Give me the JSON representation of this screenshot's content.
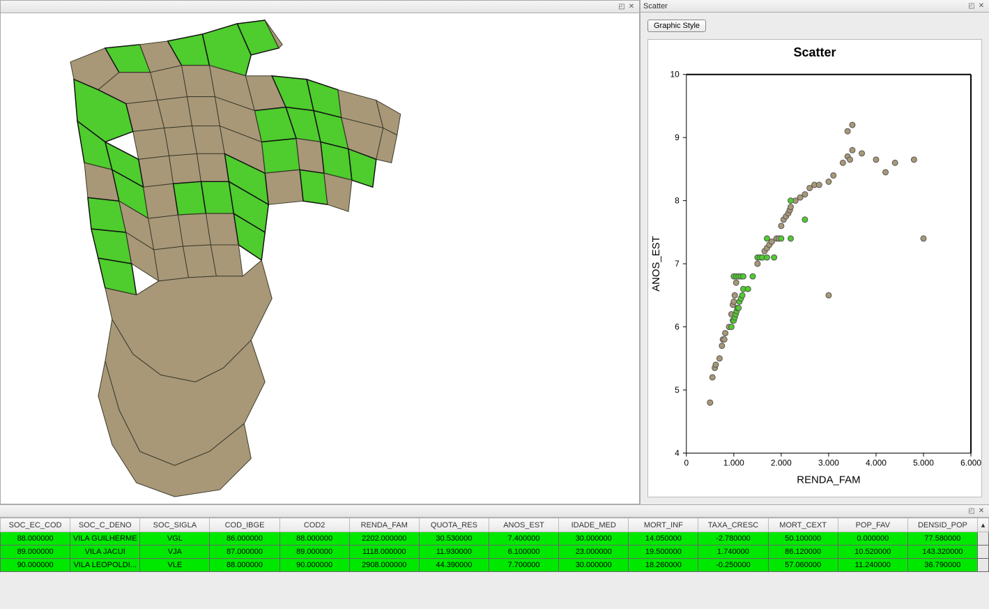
{
  "panels": {
    "map": {
      "title": ""
    },
    "scatter": {
      "title": "Scatter",
      "button": "Graphic Style"
    },
    "table": {
      "title": ""
    }
  },
  "icons": {
    "undock": "◰",
    "close": "✕",
    "up": "▴"
  },
  "chart_data": {
    "type": "scatter",
    "title": "Scatter",
    "xlabel": "RENDA_FAM",
    "ylabel": "ANOS_EST",
    "xlim": [
      0,
      6000
    ],
    "ylim": [
      4,
      10
    ],
    "xticks": [
      0,
      1000,
      2000,
      3000,
      4000,
      5000,
      6000
    ],
    "xticklabels": [
      "0",
      "1.000",
      "2.000",
      "3.000",
      "4.000",
      "5.000",
      "6.000"
    ],
    "yticks": [
      4,
      5,
      6,
      7,
      8,
      9,
      10
    ],
    "series": [
      {
        "name": "unselected",
        "color": "#a89878",
        "points": [
          [
            500,
            4.8
          ],
          [
            550,
            5.2
          ],
          [
            600,
            5.35
          ],
          [
            620,
            5.4
          ],
          [
            700,
            5.5
          ],
          [
            750,
            5.7
          ],
          [
            770,
            5.8
          ],
          [
            800,
            5.8
          ],
          [
            820,
            5.9
          ],
          [
            900,
            6.0
          ],
          [
            950,
            6.2
          ],
          [
            980,
            6.35
          ],
          [
            1000,
            6.4
          ],
          [
            1020,
            6.5
          ],
          [
            1050,
            6.7
          ],
          [
            1500,
            7.0
          ],
          [
            1600,
            7.1
          ],
          [
            1650,
            7.2
          ],
          [
            1700,
            7.25
          ],
          [
            1750,
            7.3
          ],
          [
            1800,
            7.35
          ],
          [
            1900,
            7.4
          ],
          [
            1950,
            7.4
          ],
          [
            2000,
            7.6
          ],
          [
            2050,
            7.7
          ],
          [
            2100,
            7.75
          ],
          [
            2150,
            7.8
          ],
          [
            2180,
            7.85
          ],
          [
            2200,
            7.9
          ],
          [
            2300,
            8.0
          ],
          [
            2400,
            8.05
          ],
          [
            2500,
            8.1
          ],
          [
            2600,
            8.2
          ],
          [
            2700,
            8.25
          ],
          [
            2800,
            8.25
          ],
          [
            3000,
            8.3
          ],
          [
            3100,
            8.4
          ],
          [
            3300,
            8.6
          ],
          [
            3400,
            8.7
          ],
          [
            3450,
            8.65
          ],
          [
            3500,
            8.8
          ],
          [
            3700,
            8.75
          ],
          [
            4000,
            8.65
          ],
          [
            4200,
            8.45
          ],
          [
            4400,
            8.6
          ],
          [
            4800,
            8.65
          ],
          [
            3400,
            9.1
          ],
          [
            3500,
            9.2
          ],
          [
            5000,
            7.4
          ],
          [
            3000,
            6.5
          ]
        ]
      },
      {
        "name": "selected",
        "color": "#4fcc2e",
        "points": [
          [
            950,
            6.0
          ],
          [
            980,
            6.1
          ],
          [
            1000,
            6.1
          ],
          [
            1020,
            6.15
          ],
          [
            1040,
            6.2
          ],
          [
            1060,
            6.25
          ],
          [
            1080,
            6.3
          ],
          [
            1100,
            6.3
          ],
          [
            1120,
            6.4
          ],
          [
            1150,
            6.45
          ],
          [
            1180,
            6.5
          ],
          [
            1200,
            6.6
          ],
          [
            1300,
            6.6
          ],
          [
            1000,
            6.8
          ],
          [
            1050,
            6.8
          ],
          [
            1100,
            6.8
          ],
          [
            1150,
            6.8
          ],
          [
            1200,
            6.8
          ],
          [
            1400,
            6.8
          ],
          [
            1500,
            7.1
          ],
          [
            1550,
            7.1
          ],
          [
            1600,
            7.1
          ],
          [
            1700,
            7.1
          ],
          [
            1850,
            7.1
          ],
          [
            1700,
            7.4
          ],
          [
            2000,
            7.4
          ],
          [
            2200,
            7.4
          ],
          [
            2500,
            7.7
          ],
          [
            2200,
            8.0
          ]
        ]
      }
    ]
  },
  "table": {
    "columns": [
      "SOC_EC_COD",
      "SOC_C_DENO",
      "SOC_SIGLA",
      "COD_IBGE",
      "COD2",
      "RENDA_FAM",
      "QUOTA_RES",
      "ANOS_EST",
      "IDADE_MED",
      "MORT_INF",
      "TAXA_CRESC",
      "MORT_CEXT",
      "POP_FAV",
      "DENSID_POP"
    ],
    "rows": [
      [
        "88.000000",
        "VILA GUILHERME",
        "VGL",
        "86.000000",
        "88.000000",
        "2202.000000",
        "30.530000",
        "7.400000",
        "30.000000",
        "14.050000",
        "-2.780000",
        "50.100000",
        "0.000000",
        "77.580000"
      ],
      [
        "89.000000",
        "VILA JACUI",
        "VJA",
        "87.000000",
        "89.000000",
        "1118.000000",
        "11.930000",
        "6.100000",
        "23.000000",
        "19.500000",
        "1.740000",
        "86.120000",
        "10.520000",
        "143.320000"
      ],
      [
        "90.000000",
        "VILA LEOPOLDI...",
        "VLE",
        "88.000000",
        "90.000000",
        "2908.000000",
        "44.390000",
        "7.700000",
        "30.000000",
        "18.260000",
        "-0.250000",
        "57.060000",
        "11.240000",
        "36.790000"
      ]
    ]
  },
  "map": {
    "colors": {
      "selected": "#4fcc2e",
      "unselected": "#a89878"
    }
  }
}
